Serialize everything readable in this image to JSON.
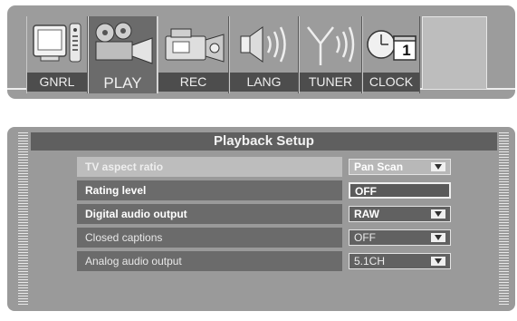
{
  "tabs": [
    {
      "label": "GNRL",
      "icon": "tv-remote-icon"
    },
    {
      "label": "PLAY",
      "icon": "film-projector-icon",
      "active": true
    },
    {
      "label": "REC",
      "icon": "camcorder-icon"
    },
    {
      "label": "LANG",
      "icon": "speaker-icon"
    },
    {
      "label": "TUNER",
      "icon": "antenna-icon"
    },
    {
      "label": "CLOCK",
      "icon": "clock-calendar-icon",
      "calendar_day": "1"
    }
  ],
  "panel": {
    "title": "Playback Setup",
    "rows": [
      {
        "label": "TV  aspect  ratio",
        "value": "Pan Scan",
        "dropdown": true
      },
      {
        "label": "Rating  level",
        "value": "OFF",
        "dropdown": false
      },
      {
        "label": "Digital  audio  output",
        "value": "RAW",
        "dropdown": true
      },
      {
        "label": "Closed  captions",
        "value": "OFF",
        "dropdown": true
      },
      {
        "label": "Analog  audio  output",
        "value": "5.1CH",
        "dropdown": true
      }
    ]
  }
}
